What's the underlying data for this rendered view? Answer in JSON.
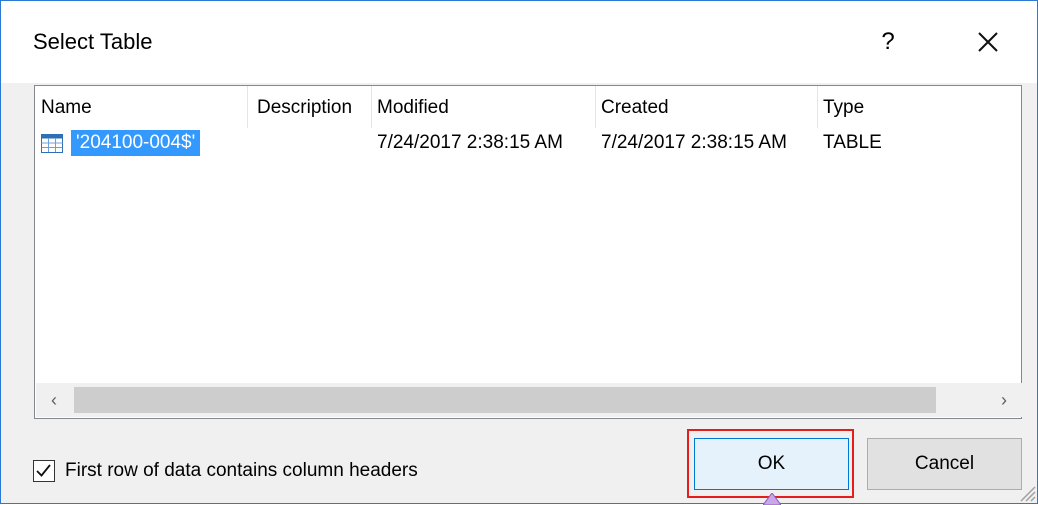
{
  "window": {
    "title": "Select Table",
    "help_label": "?"
  },
  "list": {
    "columns": [
      "Name",
      "Description",
      "Modified",
      "Created",
      "Type"
    ],
    "rows": [
      {
        "name": "'204100-004$'",
        "description": "",
        "modified": "7/24/2017 2:38:15 AM",
        "created": "7/24/2017 2:38:15 AM",
        "type": "TABLE",
        "icon": "table-icon",
        "selected": true
      }
    ],
    "scroll_left": "‹",
    "scroll_right": "›"
  },
  "options": {
    "first_row_headers_label": "First row of data contains column headers",
    "first_row_headers_checked": true
  },
  "buttons": {
    "ok": "OK",
    "cancel": "Cancel"
  },
  "colors": {
    "selection": "#3399ff",
    "highlight_box": "#e51d1d",
    "window_border": "#2b79d4"
  }
}
